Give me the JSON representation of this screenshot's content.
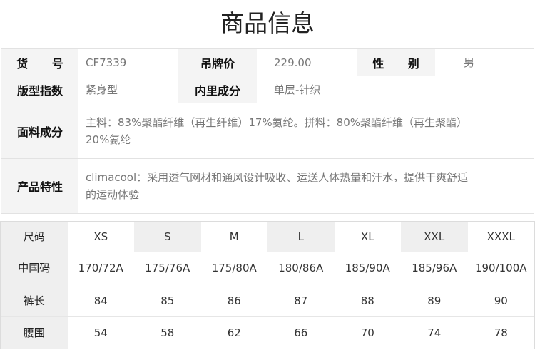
{
  "title": "商品信息",
  "info": {
    "item_no_label": "货 号",
    "item_no": "CF7339",
    "price_label": "吊牌价",
    "price": "229.00",
    "gender_label": "性 别",
    "gender": "男",
    "fit_label": "版型指数",
    "fit": "紧身型",
    "lining_label": "内里成分",
    "lining": "单层-针织",
    "fabric_label": "面料成分",
    "fabric": "主料：83%聚酯纤维（再生纤维）17%氨纶。拼料：80%聚酯纤维（再生聚酯）20%氨纶",
    "feature_label": "产品特性",
    "feature": "climacool：采用透气网材和通风设计吸收、运送人体热量和汗水，提供干爽舒适的运动体验"
  },
  "size_table": {
    "rows": [
      {
        "label": "尺码",
        "cells": [
          "XS",
          "S",
          "M",
          "L",
          "XL",
          "XXL",
          "XXXL"
        ]
      },
      {
        "label": "中国码",
        "cells": [
          "170/72A",
          "175/76A",
          "175/80A",
          "180/86A",
          "185/90A",
          "185/96A",
          "190/100A"
        ]
      },
      {
        "label": "裤长",
        "cells": [
          "84",
          "85",
          "86",
          "87",
          "88",
          "89",
          "90"
        ]
      },
      {
        "label": "腰围",
        "cells": [
          "54",
          "58",
          "62",
          "66",
          "70",
          "74",
          "78"
        ]
      }
    ]
  }
}
